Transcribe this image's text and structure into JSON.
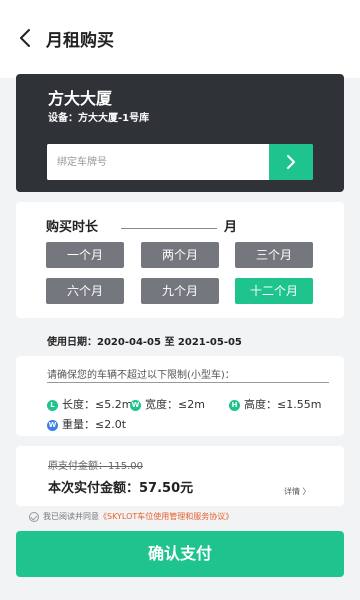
{
  "header": {
    "title": "月租购买"
  },
  "building": {
    "name": "方大大厦",
    "device": "设备：方大大厦-1号库"
  },
  "plate": {
    "placeholder": "绑定车牌号"
  },
  "duration": {
    "label": "购买时长",
    "unit": "月",
    "options": [
      {
        "label": "一个月",
        "selected": false
      },
      {
        "label": "两个月",
        "selected": false
      },
      {
        "label": "三个月",
        "selected": false
      },
      {
        "label": "六个月",
        "selected": false
      },
      {
        "label": "九个月",
        "selected": false
      },
      {
        "label": "十二个月",
        "selected": true
      }
    ]
  },
  "usage_date": "使用日期：2020-04-05 至 2021-05-05",
  "limits": {
    "title": "请确保您的车辆不超过以下限制(小型车)：",
    "length": "长度：≤5.2m",
    "width": "宽度：≤2m",
    "height": "高度：≤1.55m",
    "weight": "重量：≤2.0t"
  },
  "payment": {
    "original": "原支付金额：115.00",
    "actual": "本次实付金额：57.50元",
    "details": "详情 〉"
  },
  "agreement": {
    "prefix": "我已阅读并同意",
    "link": "《SKYLOT车位使用管理和服务协议》"
  },
  "confirm_label": "确认支付",
  "colors": {
    "accent": "#1fc38e",
    "dark_card": "#2f3237",
    "option_gray": "#74777d",
    "link_orange": "#e8612c"
  }
}
